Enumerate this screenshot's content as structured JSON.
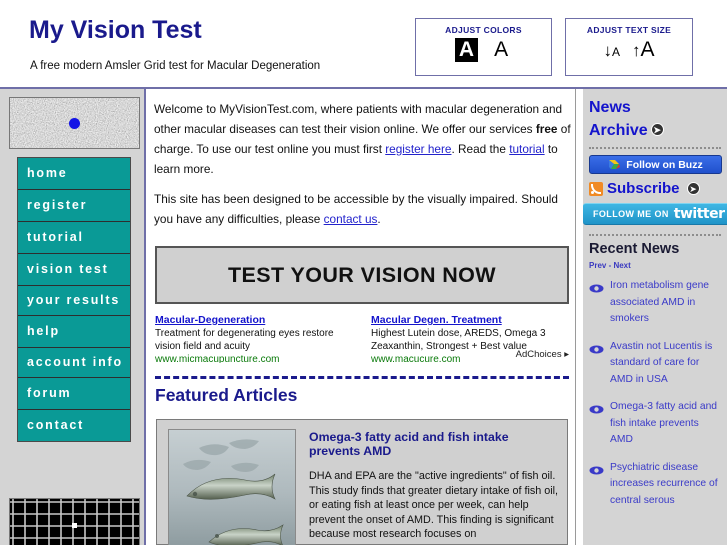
{
  "header": {
    "title": "My Vision Test",
    "tagline": "A free modern Amsler Grid test for Macular Degeneration",
    "adjust_colors": {
      "label": "ADJUST COLORS",
      "swatch_dark": "A",
      "swatch_light": "A"
    },
    "adjust_text": {
      "label": "ADJUST TEXT SIZE",
      "decrease": "↓A",
      "increase": "↑A"
    }
  },
  "left_sidebar": {
    "noise_image_name": "vision-noise-test-image",
    "nav": [
      {
        "label": "home"
      },
      {
        "label": "register"
      },
      {
        "label": "tutorial"
      },
      {
        "label": "vision test"
      },
      {
        "label": "your results"
      },
      {
        "label": "help"
      },
      {
        "label": "account info"
      },
      {
        "label": "forum"
      },
      {
        "label": "contact"
      }
    ],
    "amsler_grid_name": "amsler-grid-thumbnail"
  },
  "main": {
    "intro_p1_before_free": "Welcome to MyVisionTest.com, where patients with macular degeneration and other macular diseases can test their vision online. We offer our services ",
    "intro_free": "free",
    "intro_p1_mid": " of charge. To use our test online you must first ",
    "intro_register_link": "register here",
    "intro_p1_mid2": ". Read the ",
    "intro_tutorial_link": "tutorial",
    "intro_p1_end": " to learn more.",
    "intro_p2_before": "This site has been designed to be accessible by the visually impaired. Should you have any difficulties, please ",
    "intro_contact_link": "contact us",
    "intro_p2_end": ".",
    "test_button": "TEST YOUR VISION NOW",
    "ads": [
      {
        "title": "Macular-Degeneration",
        "line1": "Treatment for degenerating eyes restore",
        "line2": "vision field and acuity",
        "url": "www.micmacupuncture.com"
      },
      {
        "title": "Macular Degen. Treatment",
        "line1": "Highest Lutein dose, AREDS, Omega 3",
        "line2": "Zeaxanthin, Strongest + Best value",
        "url": "www.macucure.com"
      }
    ],
    "adchoices": "AdChoices",
    "featured_title": "Featured Articles",
    "article": {
      "heading": "Omega-3 fatty acid and fish intake prevents AMD",
      "body": "DHA and EPA are the \"active ingredients\" of fish oil. This study finds that greater dietary intake of fish oil, or eating fish at least once per week, can help prevent the onset of AMD. This finding is significant because most research focuses on",
      "thumb_name": "salmon-fish-photo"
    }
  },
  "right_sidebar": {
    "news_line1": "News",
    "news_line2": "Archive",
    "buzz_button": "Follow on Buzz",
    "subscribe_label": "Subscribe",
    "twitter_prefix": "FOLLOW ME ON",
    "twitter_brand": "twitter",
    "recent_news_title": "Recent News",
    "prev_next": "Prev - Next",
    "recent_news": [
      {
        "text": "Iron metabolism gene associated AMD in smokers"
      },
      {
        "text": "Avastin not Lucentis is standard of care for AMD in USA"
      },
      {
        "text": "Omega-3 fatty acid and fish intake prevents AMD"
      },
      {
        "text": "Psychiatric disease increases recurrence of central serous"
      }
    ]
  },
  "colors": {
    "brand_blue": "#1a1a8c",
    "nav_teal": "#0a9a96",
    "link_blue": "#2222cc",
    "sidebar_gray": "#d4d4d4",
    "rule_purple": "#6f6fa8"
  }
}
